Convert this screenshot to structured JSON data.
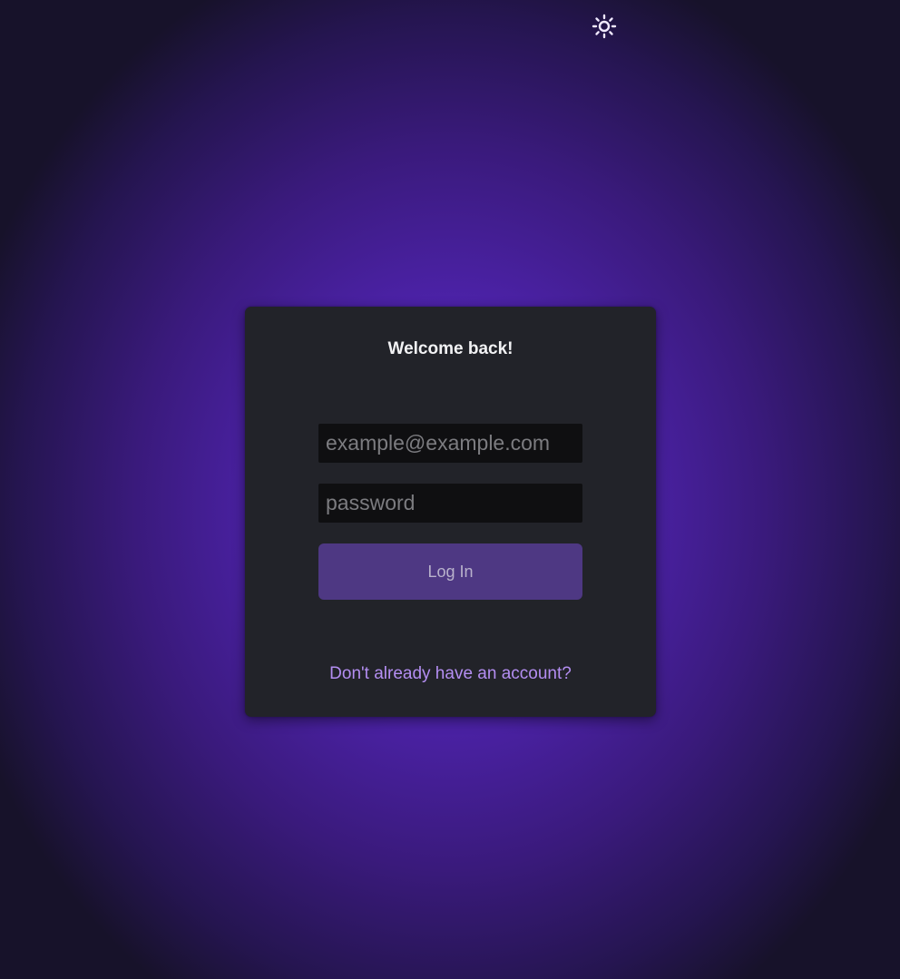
{
  "theme_toggle": {
    "icon": "sun-icon"
  },
  "login_card": {
    "title": "Welcome back!",
    "email_placeholder": "example@example.com",
    "email_value": "",
    "password_placeholder": "password",
    "password_value": "",
    "login_button_label": "Log In",
    "signup_link_text": "Don't already have an account?"
  },
  "colors": {
    "background_accent": "#5a24c6",
    "card_background": "#222329",
    "button_background": "#4e3883",
    "link_color": "#b48ef2"
  }
}
